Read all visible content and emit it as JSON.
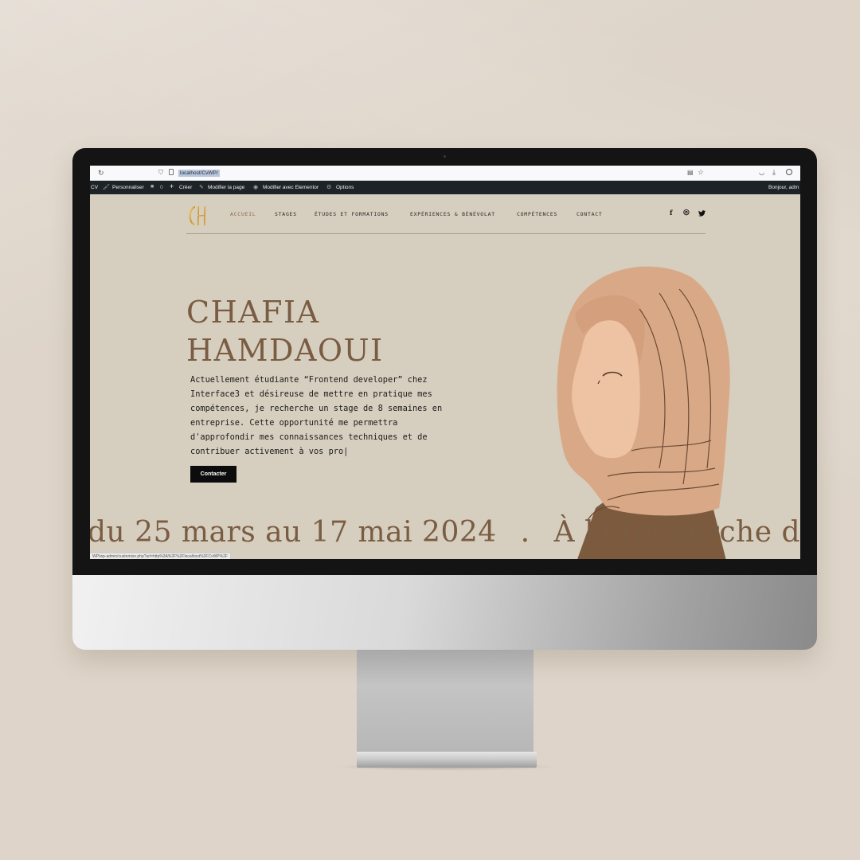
{
  "browser": {
    "url": "localhost/CvWP/",
    "status_url": "WP/wp-admin/customize.php?url=http%3A%2F%2Flocalhost%2FCvWP%2F"
  },
  "admin_bar": {
    "site": "CV",
    "customize": "Personnaliser",
    "comments_count": "0",
    "new": "Créer",
    "edit_page": "Modifier la page",
    "edit_elementor": "Modifier avec Elementor",
    "options": "Options",
    "greeting": "Bonjour, adm"
  },
  "nav": {
    "items": [
      {
        "label": "ACCUEIL"
      },
      {
        "label": "STAGES"
      },
      {
        "label": "ÉTUDES ET FORMATIONS"
      },
      {
        "label": "EXPÉRIENCES & BÉNÉVOLAT"
      },
      {
        "label": "COMPÉTENCES"
      },
      {
        "label": "CONTACT"
      }
    ],
    "social": {
      "facebook": "f",
      "instagram": "◎",
      "twitter": "🐦"
    }
  },
  "hero": {
    "first_name": "CHAFIA",
    "last_name": "HAMDAOUI",
    "text": "Actuellement étudiante “Frontend developer” chez\nInterface3 et désireuse de mettre en pratique mes\ncompétences, je recherche un stage de 8 semaines en\nentreprise. Cette opportunité me permettra\nd'approfondir mes connaissances techniques et de\ncontribuer activement à vos pro|",
    "button": "Contacter"
  },
  "marquee": {
    "part1": "du 25 mars au 17 mai 2024",
    "sep": ".",
    "part2": "À la recherche d’un"
  },
  "colors": {
    "accent": "#7a5c43",
    "site_bg": "#d6cebe",
    "admin_bar": "#1d2327"
  }
}
